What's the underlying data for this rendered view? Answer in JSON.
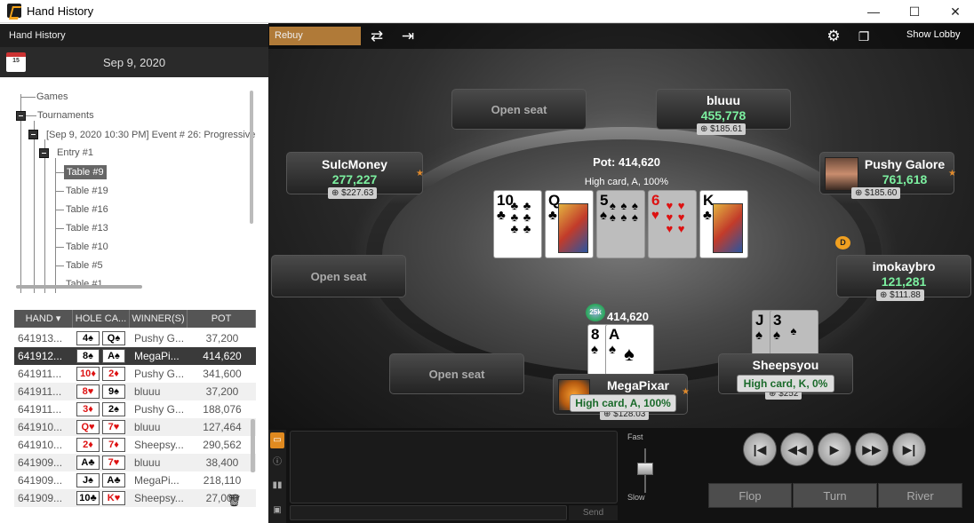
{
  "window": {
    "title": "Hand History",
    "minimize": "—",
    "maximize": "☐",
    "close": "✕"
  },
  "left_panel": {
    "header": "Hand History",
    "calendar_day": "15",
    "date": "Sep 9, 2020",
    "tree": {
      "games": "Games",
      "tournaments": "Tournaments",
      "event": "[Sep 9, 2020 10:30 PM] Event # 26: Progressive",
      "entry": "Entry #1",
      "tables": [
        "Table #9",
        "Table #19",
        "Table #16",
        "Table #13",
        "Table #10",
        "Table #5",
        "Table #1"
      ],
      "selected_table": "Table #9"
    },
    "hands_table": {
      "headers": [
        "HAND",
        "HOLE CA...",
        "WINNER(S)",
        "POT"
      ],
      "rows": [
        {
          "hand": "641913...",
          "c1r": "4",
          "c1s": "♠",
          "c1red": false,
          "c2r": "Q",
          "c2s": "♠",
          "c2red": false,
          "winner": "Pushy G...",
          "pot": "37,200"
        },
        {
          "hand": "641912...",
          "c1r": "8",
          "c1s": "♠",
          "c1red": false,
          "c2r": "A",
          "c2s": "♠",
          "c2red": false,
          "winner": "MegaPi...",
          "pot": "414,620"
        },
        {
          "hand": "641911...",
          "c1r": "10",
          "c1s": "♦",
          "c1red": true,
          "c2r": "2",
          "c2s": "♦",
          "c2red": true,
          "winner": "Pushy G...",
          "pot": "341,600"
        },
        {
          "hand": "641911...",
          "c1r": "8",
          "c1s": "♥",
          "c1red": true,
          "c2r": "9",
          "c2s": "♠",
          "c2red": false,
          "winner": "bluuu",
          "pot": "37,200"
        },
        {
          "hand": "641911...",
          "c1r": "3",
          "c1s": "♦",
          "c1red": true,
          "c2r": "2",
          "c2s": "♠",
          "c2red": false,
          "winner": "Pushy G...",
          "pot": "188,076"
        },
        {
          "hand": "641910...",
          "c1r": "Q",
          "c1s": "♥",
          "c1red": true,
          "c2r": "7",
          "c2s": "♥",
          "c2red": true,
          "winner": "bluuu",
          "pot": "127,464"
        },
        {
          "hand": "641910...",
          "c1r": "2",
          "c1s": "♦",
          "c1red": true,
          "c2r": "7",
          "c2s": "♦",
          "c2red": true,
          "winner": "Sheepsy...",
          "pot": "290,562"
        },
        {
          "hand": "641909...",
          "c1r": "A",
          "c1s": "♣",
          "c1red": false,
          "c2r": "7",
          "c2s": "♥",
          "c2red": true,
          "winner": "bluuu",
          "pot": "38,400"
        },
        {
          "hand": "641909...",
          "c1r": "J",
          "c1s": "♠",
          "c1red": false,
          "c2r": "A",
          "c2s": "♣",
          "c2red": false,
          "winner": "MegaPi...",
          "pot": "218,110"
        },
        {
          "hand": "641909...",
          "c1r": "10",
          "c1s": "♣",
          "c1red": false,
          "c2r": "K",
          "c2s": "♥",
          "c2red": true,
          "winner": "Sheepsy...",
          "pot": "27,000"
        }
      ],
      "selected_index": 1
    }
  },
  "table": {
    "rebuy": "Rebuy",
    "show_lobby": "Show Lobby",
    "pot": "Pot: 414,620",
    "best_hand": "High card, A, 100%",
    "open_seat": "Open seat",
    "board": [
      {
        "rank": "10",
        "suit": "♣",
        "red": false,
        "dim": false,
        "face": false
      },
      {
        "rank": "Q",
        "suit": "♣",
        "red": false,
        "dim": false,
        "face": true
      },
      {
        "rank": "5",
        "suit": "♠",
        "red": false,
        "dim": true,
        "face": false
      },
      {
        "rank": "6",
        "suit": "♥",
        "red": true,
        "dim": true,
        "face": false
      },
      {
        "rank": "K",
        "suit": "♣",
        "red": false,
        "dim": false,
        "face": true
      }
    ],
    "players": {
      "bluuu": {
        "name": "bluuu",
        "stack": "455,778",
        "bounty": "$185.61"
      },
      "sulcmoney": {
        "name": "SulcMoney",
        "stack": "277,227",
        "bounty": "$227.63"
      },
      "pushy": {
        "name": "Pushy Galore",
        "stack": "761,618",
        "bounty": "$185.60"
      },
      "imokay": {
        "name": "imokaybro",
        "stack": "121,281",
        "bounty": "$111.88"
      },
      "sheeps": {
        "name": "Sheepsyou",
        "hand_result": "High card, K, 0%",
        "bounty": "$252",
        "c1r": "J",
        "c1s": "♠",
        "c2r": "3",
        "c2s": "♠"
      },
      "mega": {
        "name": "MegaPixar",
        "hand_result": "High card, A, 100%",
        "bounty": "$128.03",
        "bet": "414,620",
        "chip": "25k",
        "c1r": "8",
        "c1s": "♠",
        "c2r": "A",
        "c2s": "♠"
      }
    },
    "dealer_button": "D"
  },
  "bottom": {
    "send": "Send",
    "fast": "Fast",
    "slow": "Slow",
    "streets": [
      "Flop",
      "Turn",
      "River"
    ]
  }
}
